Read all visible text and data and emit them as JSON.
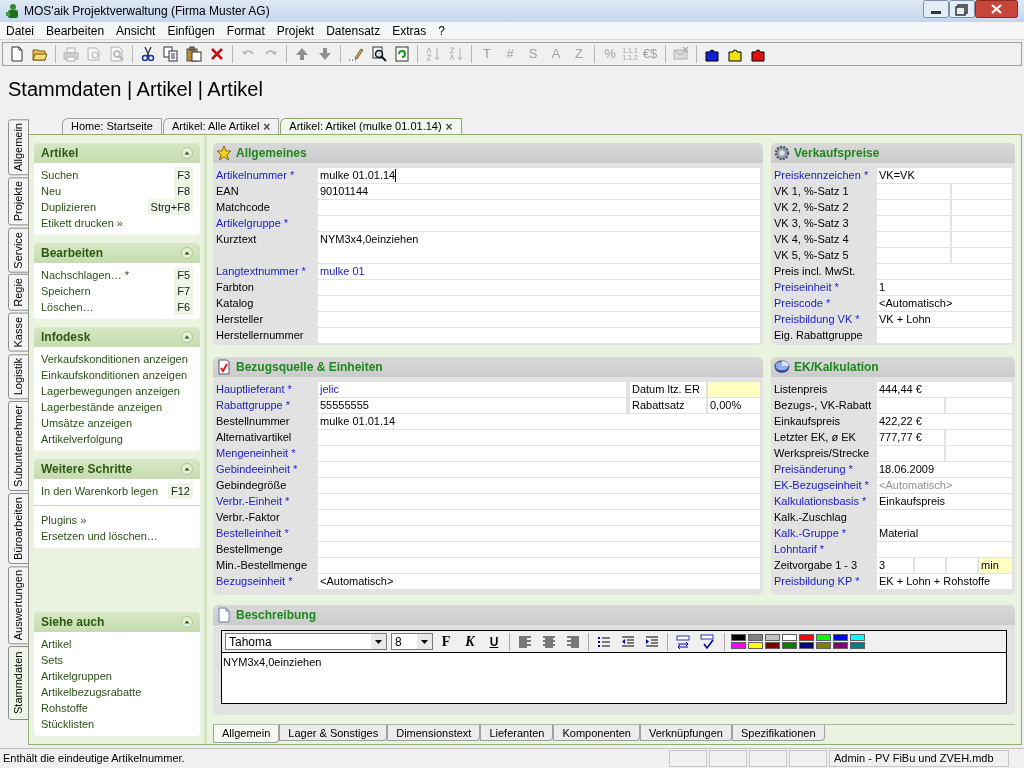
{
  "window": {
    "title": "MOS'aik Projektverwaltung (Firma Muster AG)"
  },
  "menu": [
    "Datei",
    "Bearbeiten",
    "Ansicht",
    "Einfügen",
    "Format",
    "Projekt",
    "Datensatz",
    "Extras",
    "?"
  ],
  "toolbar": [
    {
      "kind": "icon",
      "disabled": false
    },
    {
      "kind": "icon",
      "disabled": false
    },
    {
      "kind": "separator"
    },
    {
      "kind": "icon",
      "disabled": true
    },
    {
      "kind": "icon",
      "disabled": true
    },
    {
      "kind": "icon",
      "disabled": true
    },
    {
      "kind": "separator"
    },
    {
      "kind": "icon",
      "disabled": false
    },
    {
      "kind": "icon",
      "disabled": false
    },
    {
      "kind": "icon",
      "disabled": false
    },
    {
      "kind": "icon",
      "disabled": false
    },
    {
      "kind": "separator"
    },
    {
      "kind": "icon",
      "disabled": true
    },
    {
      "kind": "icon",
      "disabled": true
    },
    {
      "kind": "separator"
    },
    {
      "kind": "icon",
      "disabled": false
    },
    {
      "kind": "icon",
      "disabled": false
    },
    {
      "kind": "separator"
    },
    {
      "kind": "icon",
      "disabled": false
    },
    {
      "kind": "icon",
      "disabled": false
    },
    {
      "kind": "icon",
      "disabled": false
    },
    {
      "kind": "separator"
    },
    {
      "kind": "icon",
      "disabled": true
    },
    {
      "kind": "icon",
      "disabled": true
    },
    {
      "kind": "separator"
    },
    {
      "kind": "glyph",
      "text": "T",
      "disabled": true
    },
    {
      "kind": "glyph",
      "text": "#",
      "disabled": true
    },
    {
      "kind": "glyph",
      "text": "S",
      "disabled": true
    },
    {
      "kind": "glyph",
      "text": "A",
      "disabled": true
    },
    {
      "kind": "glyph",
      "text": "Z",
      "disabled": true
    },
    {
      "kind": "separator"
    },
    {
      "kind": "glyph",
      "text": "%",
      "disabled": true
    },
    {
      "kind": "glyph",
      "text": "1.1.1 1.1.2",
      "disabled": true
    },
    {
      "kind": "glyph",
      "text": "€$",
      "disabled": true
    },
    {
      "kind": "separator"
    },
    {
      "kind": "icon",
      "disabled": true
    },
    {
      "kind": "separator"
    },
    {
      "kind": "icon",
      "disabled": false
    },
    {
      "kind": "icon",
      "disabled": false
    },
    {
      "kind": "icon",
      "disabled": false
    }
  ],
  "breadcrumb": "Stammdaten | Artikel | Artikel",
  "side_tabs": [
    {
      "label": "Allgemein",
      "selected": false
    },
    {
      "label": "Projekte",
      "selected": false
    },
    {
      "label": "Service",
      "selected": false
    },
    {
      "label": "Regie",
      "selected": false
    },
    {
      "label": "Kasse",
      "selected": false
    },
    {
      "label": "Logistik",
      "selected": false
    },
    {
      "label": "Subunternehmer",
      "selected": false
    },
    {
      "label": "Büroarbeiten",
      "selected": false
    },
    {
      "label": "Auswertungen",
      "selected": false
    },
    {
      "label": "Stammdaten",
      "selected": true
    }
  ],
  "doc_tabs": [
    {
      "label": "Home: Startseite",
      "selected": false
    },
    {
      "label": "Artikel: Alle Artikel",
      "close": "×",
      "selected": false
    },
    {
      "label": "Artikel: Artikel (mulke 01.01.14)",
      "close": "×",
      "selected": true
    }
  ],
  "sidebar": {
    "sections": [
      {
        "title": "Artikel",
        "items": [
          {
            "label": "Suchen",
            "shortcut": "F3"
          },
          {
            "label": "Neu",
            "shortcut": "F8"
          },
          {
            "label": "Duplizieren",
            "shortcut": "Strg+F8"
          },
          {
            "label": "Etikett drucken »"
          }
        ]
      },
      {
        "title": "Bearbeiten",
        "items": [
          {
            "label": "Nachschlagen… *",
            "shortcut": "F5"
          },
          {
            "label": "Speichern",
            "shortcut": "F7"
          },
          {
            "label": "Löschen…",
            "shortcut": "F6"
          }
        ]
      },
      {
        "title": "Infodesk",
        "items": [
          {
            "label": "Verkaufskonditionen anzeigen"
          },
          {
            "label": "Einkaufskonditionen anzeigen"
          },
          {
            "label": "Lagerbewegungen anzeigen"
          },
          {
            "label": "Lagerbestände anzeigen"
          },
          {
            "label": "Umsätze anzeigen"
          },
          {
            "label": "Artikelverfolgung"
          }
        ]
      },
      {
        "title": "Weitere Schritte",
        "items": [
          {
            "label": "In den Warenkorb legen",
            "shortcut": "F12"
          }
        ],
        "more_items": [
          {
            "label": "Plugins »"
          },
          {
            "label": "Ersetzen und löschen…"
          }
        ]
      }
    ],
    "bottom_section": {
      "title": "Siehe auch",
      "items": [
        {
          "label": "Artikel"
        },
        {
          "label": "Sets"
        },
        {
          "label": "Artikelgruppen"
        },
        {
          "label": "Artikelbezugsrabatte"
        },
        {
          "label": "Rohstoffe"
        },
        {
          "label": "Stücklisten"
        }
      ]
    }
  },
  "allgemeines": {
    "title": "Allgemeines",
    "fields": [
      {
        "label": "Artikelnummer *",
        "required": true,
        "kind": "text",
        "value": "mulke 01.01.14",
        "focused": true
      },
      {
        "label": "EAN",
        "required": false,
        "kind": "text",
        "value": "90101144"
      },
      {
        "label": "Matchcode",
        "required": false,
        "kind": "text"
      },
      {
        "label": "Artikelgruppe *",
        "required": true,
        "kind": "text"
      },
      {
        "label": "Kurztext",
        "required": false,
        "kind": "multiline",
        "value": "NYM3x4,0einziehen"
      },
      {
        "label": "Langtextnummer *",
        "required": true,
        "kind": "text",
        "value": "mulke 01",
        "link": true
      },
      {
        "label": "Farbton",
        "required": false,
        "kind": "text"
      },
      {
        "label": "Katalog",
        "required": false,
        "kind": "text"
      },
      {
        "label": "Hersteller",
        "required": false,
        "kind": "text"
      },
      {
        "label": "Herstellernummer",
        "required": false,
        "kind": "text"
      }
    ]
  },
  "bezugsquelle": {
    "title": "Bezugsquelle & Einheiten",
    "fields": [
      {
        "label": "Hauptlieferant *",
        "required": true,
        "kind": "text",
        "value": "jelic",
        "link": true,
        "side": {
          "label": "Datum ltz. ER",
          "highlight": true
        }
      },
      {
        "label": "Rabattgruppe *",
        "required": true,
        "kind": "text",
        "value": "55555555",
        "side": {
          "label": "Rabattsatz",
          "value": "0,00%",
          "highlight": false
        }
      },
      {
        "label": "Bestellnummer",
        "required": false,
        "kind": "text",
        "value": "mulke 01.01.14"
      },
      {
        "label": "Alternativartikel",
        "required": false,
        "kind": "text"
      },
      {
        "label": "Mengeneinheit *",
        "required": true,
        "kind": "text"
      },
      {
        "label": "Gebindeeinheit *",
        "required": true,
        "kind": "text"
      },
      {
        "label": "Gebindegröße",
        "required": false,
        "kind": "text"
      },
      {
        "label": "Verbr.-Einheit *",
        "required": true,
        "kind": "text"
      },
      {
        "label": "Verbr.-Faktor",
        "required": false,
        "kind": "text"
      },
      {
        "label": "Bestelleinheit *",
        "required": true,
        "kind": "text"
      },
      {
        "label": "Bestellmenge",
        "required": false,
        "kind": "text"
      },
      {
        "label": "Min.-Bestellmenge",
        "required": false,
        "kind": "text"
      },
      {
        "label": "Bezugseinheit *",
        "required": true,
        "kind": "text",
        "value": "<Automatisch>"
      }
    ]
  },
  "verkaufspreise": {
    "title": "Verkaufspreise",
    "rows": [
      {
        "label": "Preiskennzeichen *",
        "required": true,
        "kind": "single",
        "values": [
          "VK=VK"
        ]
      },
      {
        "label": "VK 1, %-Satz 1",
        "required": false,
        "kind": "double"
      },
      {
        "label": "VK 2, %-Satz 2",
        "required": false,
        "kind": "double"
      },
      {
        "label": "VK 3, %-Satz 3",
        "required": false,
        "kind": "double"
      },
      {
        "label": "VK 4, %-Satz 4",
        "required": false,
        "kind": "double"
      },
      {
        "label": "VK 5, %-Satz 5",
        "required": false,
        "kind": "double"
      },
      {
        "label": "Preis incl. MwSt.",
        "required": false,
        "kind": "single"
      },
      {
        "label": "Preiseinheit *",
        "required": true,
        "kind": "single",
        "values": [
          "1"
        ]
      },
      {
        "label": "Preiscode *",
        "required": true,
        "kind": "single",
        "values": [
          "<Automatisch>"
        ]
      },
      {
        "label": "Preisbildung VK *",
        "required": true,
        "kind": "single",
        "values": [
          "VK + Lohn"
        ]
      },
      {
        "label": "Eig. Rabattgruppe",
        "required": false,
        "kind": "single"
      }
    ]
  },
  "ek_kalkulation": {
    "title": "EK/Kalkulation",
    "rows": [
      {
        "label": "Listenpreis",
        "required": false,
        "kind": "single",
        "values": [
          "444,44 €"
        ]
      },
      {
        "label": "Bezugs-, VK-Rabatt",
        "required": false,
        "kind": "double"
      },
      {
        "label": "Einkaufspreis",
        "required": false,
        "kind": "single",
        "values": [
          "422,22 €"
        ]
      },
      {
        "label": "Letzter EK, ø EK",
        "required": false,
        "kind": "double",
        "values": [
          "777,77 €"
        ]
      },
      {
        "label": "Werkspreis/Strecke",
        "required": false,
        "kind": "double"
      },
      {
        "label": "Preisänderung *",
        "required": true,
        "kind": "single",
        "values": [
          "18.06.2009"
        ]
      },
      {
        "label": "EK-Bezugseinheit *",
        "required": true,
        "kind": "single",
        "values": [
          "<Automatisch>"
        ],
        "dimmed": true
      },
      {
        "label": "Kalkulationsbasis *",
        "required": true,
        "kind": "single",
        "values": [
          "Einkaufspreis"
        ]
      },
      {
        "label": "Kalk.-Zuschlag",
        "required": false,
        "kind": "single"
      },
      {
        "label": "Kalk.-Gruppe *",
        "required": true,
        "kind": "single",
        "values": [
          "Material"
        ]
      },
      {
        "label": "Lohntarif *",
        "required": true,
        "kind": "single"
      },
      {
        "label": "Zeitvorgabe 1 - 3",
        "required": false,
        "kind": "quad",
        "values": [
          "3"
        ],
        "unit": "min"
      },
      {
        "label": "Preisbildung KP *",
        "required": true,
        "kind": "single",
        "values": [
          "EK + Lohn + Rohstoffe"
        ]
      }
    ]
  },
  "beschreibung": {
    "title": "Beschreibung",
    "font": "Tahoma",
    "size": "8",
    "format_buttons": [
      "F",
      "K",
      "U"
    ],
    "palette": [
      {
        "color": "#000000"
      },
      {
        "color": "#808080"
      },
      {
        "color": "#c0c0c0"
      },
      {
        "color": "#ffffff"
      },
      {
        "color": "#ff0000"
      },
      {
        "color": "#00ff00"
      },
      {
        "color": "#0000ff"
      },
      {
        "color": "#00ffff"
      },
      {
        "color": "#ff00ff"
      },
      {
        "color": "#ffff00"
      },
      {
        "color": "#800000"
      },
      {
        "color": "#008000"
      },
      {
        "color": "#000080"
      },
      {
        "color": "#808000"
      },
      {
        "color": "#800080"
      },
      {
        "color": "#008080"
      }
    ],
    "text": "NYM3x4,0einziehen"
  },
  "bottom_tabs": [
    {
      "label": "Allgemein",
      "selected": true
    },
    {
      "label": "Lager & Sonstiges",
      "selected": false
    },
    {
      "label": "Dimensionstext",
      "selected": false
    },
    {
      "label": "Lieferanten",
      "selected": false
    },
    {
      "label": "Komponenten",
      "selected": false
    },
    {
      "label": "Verknüpfungen",
      "selected": false
    },
    {
      "label": "Spezifikationen",
      "selected": false
    }
  ],
  "status_bar": {
    "message": "Enthält die eindeutige Artikelnummer.",
    "user": "Admin - PV FiBu und ZVEH.mdb"
  }
}
